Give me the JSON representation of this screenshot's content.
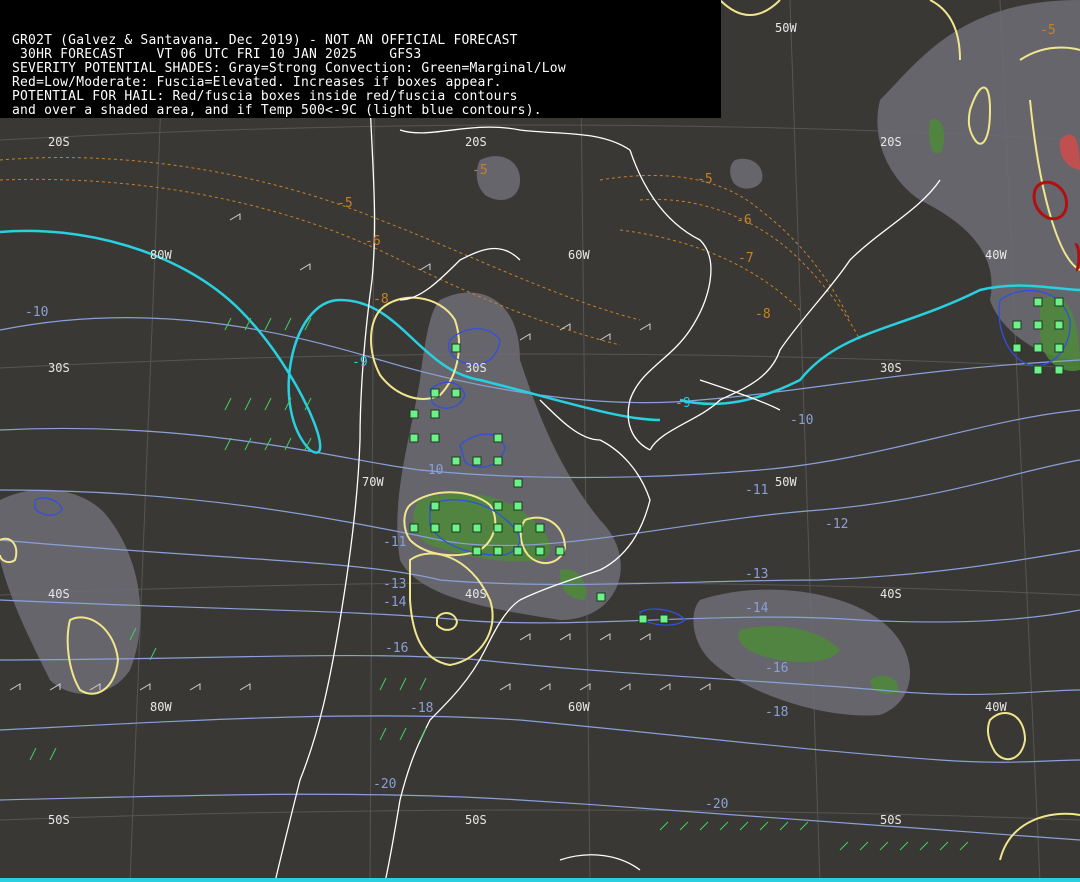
{
  "header": {
    "line1": "GR02T (Galvez & Santavana. Dec 2019) - NOT AN OFFICIAL FORECAST",
    "line2": " 30HR FORECAST    VT 06 UTC FRI 10 JAN 2025    GFS3",
    "line3": "SEVERITY POTENTIAL SHADES: Gray=Strong Convection: Green=Marginal/Low",
    "line4": "Red=Low/Moderate: Fuscia=Elevated. Increases if boxes appear.",
    "line5": "POTENTIAL FOR HAIL: Red/fuscia boxes inside red/fuscia contours",
    "line6": "and over a shaded area, and if Temp 500<-9C (light blue contours)."
  },
  "grid_labels": {
    "lat20a": "20S",
    "lat20b": "20S",
    "lat20c": "20S",
    "lat30a": "30S",
    "lat30b": "30S",
    "lat30c": "30S",
    "lat40a": "40S",
    "lat40b": "40S",
    "lat40c": "40S",
    "lat50a": "50S",
    "lat50b": "50S",
    "lat50c": "50S",
    "lon50a": "50W",
    "lon50b": "50W",
    "lon60a": "60W",
    "lon60b": "60W",
    "lon70a": "70W",
    "lon80a": "80W",
    "lon80b": "80W",
    "lon40a": "40W",
    "lon40b": "40W"
  },
  "temperature_labels": {
    "t_m5a": "-5",
    "t_m5b": "-5",
    "t_m5c": "-5",
    "t_m5d": "-5",
    "t_m6a": "-6",
    "t_m6b": "-6",
    "t_m7": "-7",
    "t_m8a": "-8",
    "t_m8b": "-8",
    "t_m9a": "-9",
    "t_m9b": "-9",
    "t_m10a": "-10",
    "t_m10b": "-10",
    "t_m10c": "-10",
    "t_m11a": "-11",
    "t_m11b": "-11",
    "t_m12": "-12",
    "t_m13a": "-13",
    "t_m13b": "-13",
    "t_m14a": "-14",
    "t_m14b": "-14",
    "t_m16a": "-16",
    "t_m16b": "-16",
    "t_m18a": "-18",
    "t_m18b": "-18",
    "t_m20a": "-20",
    "t_m20b": "-20"
  },
  "colors": {
    "background": "#3a3835",
    "gray_shade": "#6b6a72",
    "green_shade": "#4e8a3a",
    "red_shade": "#c05050",
    "yellow_contour": "#f0e68c",
    "cyan_contour": "#28d0e0",
    "lightblue_contour": "#8aa0d8",
    "blue_contour": "#3050e0",
    "orange_contour": "#c8802a",
    "hail_box": "#6ef08a",
    "coastline": "#ffffff"
  }
}
